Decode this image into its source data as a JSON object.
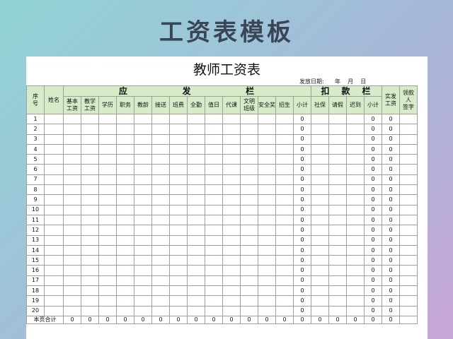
{
  "banner": {
    "title": "工资表模板"
  },
  "sheet": {
    "title": "教师工资表",
    "issue_date": "发放日期:      年    月    日"
  },
  "header": {
    "seq": "序\n号",
    "name": "姓名",
    "group_due": [
      "应",
      "发",
      "栏"
    ],
    "group_deduct": [
      "扣",
      "款",
      "栏"
    ],
    "actual": "实发\n工资",
    "sign": "领款\n人\n签字",
    "due_cols": [
      "基本\n工资",
      "教学\n工资",
      "学历",
      "职务",
      "教龄",
      "接送",
      "班费",
      "全勤",
      "值日",
      "代课",
      "文明\n班级",
      "安全奖",
      "招生",
      "小计"
    ],
    "deduct_cols": [
      "社保",
      "请假",
      "迟到",
      "小计"
    ]
  },
  "rows": [
    {
      "seq": "1",
      "due_subtotal": "0",
      "deduct_subtotal": "0",
      "actual": "0"
    },
    {
      "seq": "2",
      "due_subtotal": "0",
      "deduct_subtotal": "0",
      "actual": "0"
    },
    {
      "seq": "3",
      "due_subtotal": "0",
      "deduct_subtotal": "0",
      "actual": "0"
    },
    {
      "seq": "4",
      "due_subtotal": "0",
      "deduct_subtotal": "0",
      "actual": "0"
    },
    {
      "seq": "5",
      "due_subtotal": "0",
      "deduct_subtotal": "0",
      "actual": "0"
    },
    {
      "seq": "6",
      "due_subtotal": "0",
      "deduct_subtotal": "0",
      "actual": "0"
    },
    {
      "seq": "7",
      "due_subtotal": "0",
      "deduct_subtotal": "0",
      "actual": "0"
    },
    {
      "seq": "8",
      "due_subtotal": "0",
      "deduct_subtotal": "0",
      "actual": "0"
    },
    {
      "seq": "9",
      "due_subtotal": "0",
      "deduct_subtotal": "0",
      "actual": "0"
    },
    {
      "seq": "10",
      "due_subtotal": "0",
      "deduct_subtotal": "0",
      "actual": "0"
    },
    {
      "seq": "11",
      "due_subtotal": "0",
      "deduct_subtotal": "0",
      "actual": "0"
    },
    {
      "seq": "12",
      "due_subtotal": "0",
      "deduct_subtotal": "0",
      "actual": "0"
    },
    {
      "seq": "13",
      "due_subtotal": "0",
      "deduct_subtotal": "0",
      "actual": "0"
    },
    {
      "seq": "14",
      "due_subtotal": "0",
      "deduct_subtotal": "0",
      "actual": "0"
    },
    {
      "seq": "15",
      "due_subtotal": "0",
      "deduct_subtotal": "0",
      "actual": "0"
    },
    {
      "seq": "16",
      "due_subtotal": "0",
      "deduct_subtotal": "0",
      "actual": "0"
    },
    {
      "seq": "17",
      "due_subtotal": "0",
      "deduct_subtotal": "0",
      "actual": "0"
    },
    {
      "seq": "18",
      "due_subtotal": "0",
      "deduct_subtotal": "0",
      "actual": "0"
    },
    {
      "seq": "19",
      "due_subtotal": "0",
      "deduct_subtotal": "0",
      "actual": "0"
    },
    {
      "seq": "20",
      "due_subtotal": "0",
      "deduct_subtotal": "0",
      "actual": "0"
    }
  ],
  "totals": {
    "label": "本页合计",
    "values": [
      "0",
      "0",
      "0",
      "0",
      "0",
      "0",
      "0",
      "0",
      "0",
      "0",
      "0",
      "0",
      "0",
      "0",
      "0",
      "0",
      "0",
      "0",
      "0"
    ]
  },
  "colors": {
    "header_fill": "#d6ecc9",
    "grid_line": "#9aa29a"
  }
}
